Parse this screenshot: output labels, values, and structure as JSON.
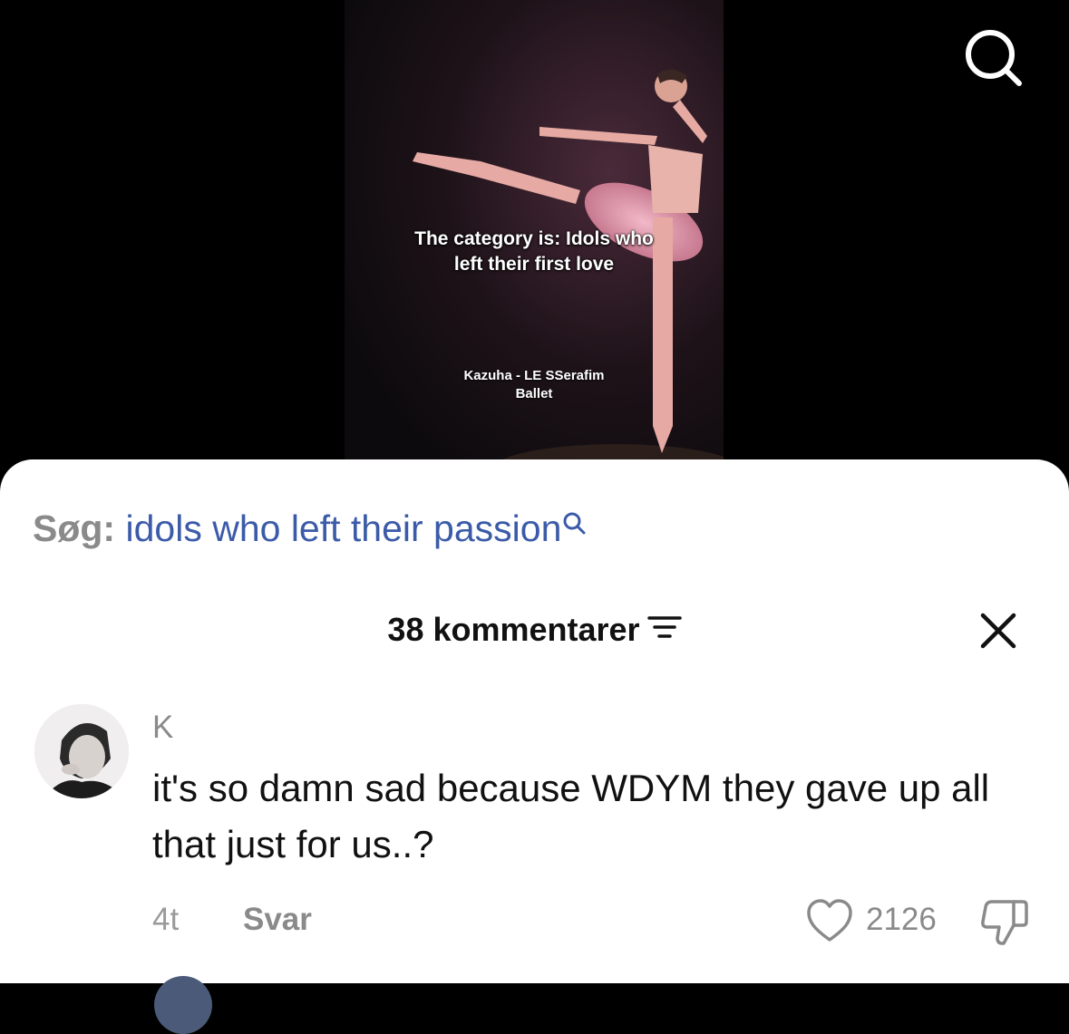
{
  "video": {
    "overlay_title_line1": "The category is: Idols who",
    "overlay_title_line2": "left their first love",
    "caption_line1": "Kazuha - LE SSerafim",
    "caption_line2": "Ballet"
  },
  "top_bar": {
    "search_icon": "search-icon"
  },
  "search_suggestion": {
    "prefix": "Søg:",
    "query": "idols who left their passion",
    "icon": "search-icon",
    "accent_color": "#3b5ba9"
  },
  "comments": {
    "header_count": "38 kommentarer",
    "sort_icon": "filter-sort-icon",
    "close_icon": "close-icon",
    "items": [
      {
        "username": "K",
        "text": "it's so damn sad because WDYM they gave up all that just for us..?",
        "time": "4t",
        "reply_label": "Svar",
        "like_count": "2126"
      }
    ]
  }
}
